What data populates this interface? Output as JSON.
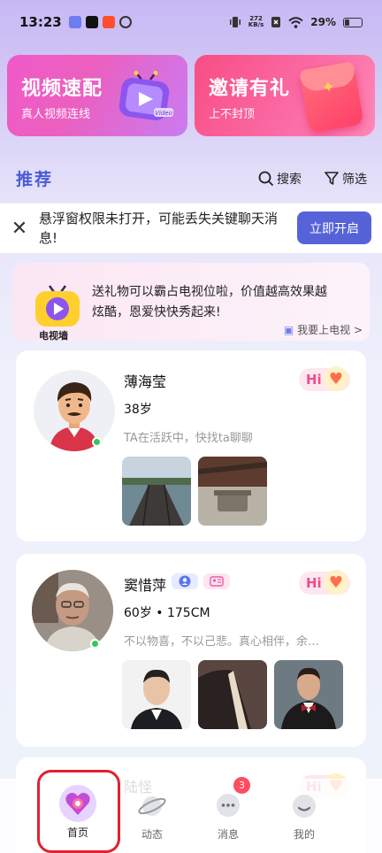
{
  "status_bar": {
    "time": "13:23",
    "net_speed_value": "272",
    "net_speed_unit": "KB/s",
    "battery": "29%"
  },
  "features": {
    "video": {
      "title": "视频速配",
      "subtitle": "真人视频连线",
      "tv_text": "Video"
    },
    "invite": {
      "title": "邀请有礼",
      "subtitle": "上不封顶"
    }
  },
  "section": {
    "title": "推荐",
    "search_label": "搜索",
    "filter_label": "筛选"
  },
  "notice": {
    "message": "悬浮窗权限未打开，可能丢失关键聊天消息!",
    "button": "立即开启"
  },
  "tvwall": {
    "logo_label": "电视墙",
    "text": "送礼物可以霸占电视位啦，价值越高效果越炫酷，恩爱快快秀起来!",
    "link": "我要上电视"
  },
  "profiles": [
    {
      "name": "薄海莹",
      "meta": "38岁",
      "description": "TA在活跃中，快找ta聊聊",
      "hi_label": "Hi"
    },
    {
      "name": "窦惜萍",
      "meta": "60岁 • 175CM",
      "description": "不以物喜，不以己悲。真心相伴，余…",
      "hi_label": "Hi"
    },
    {
      "name": "陆怪",
      "hi_label": "Hi"
    }
  ],
  "nav": {
    "items": [
      {
        "label": "首页",
        "icon": "home-heart-icon"
      },
      {
        "label": "动态",
        "icon": "planet-icon"
      },
      {
        "label": "消息",
        "icon": "message-icon",
        "badge": "3"
      },
      {
        "label": "我的",
        "icon": "profile-icon"
      }
    ]
  },
  "colors": {
    "accent": "#5663d8",
    "title_blue": "#4b5bd6",
    "hi_pink": "#f04c8c",
    "online_green": "#34c759",
    "badge_red": "#ff4d5e"
  }
}
